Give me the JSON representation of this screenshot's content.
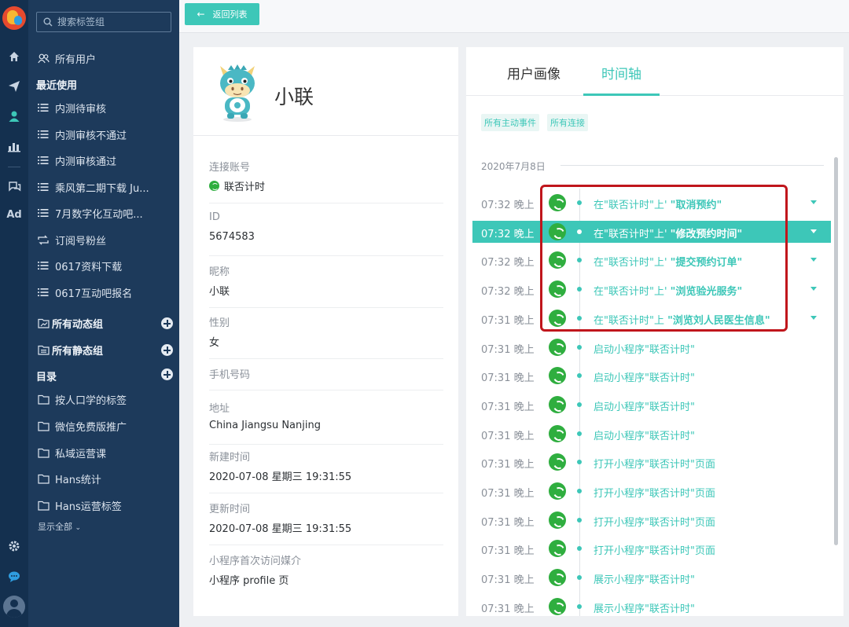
{
  "sidebar": {
    "search_placeholder": "搜索标签组",
    "all_users": "所有用户",
    "recent_header": "最近使用",
    "recent_items": [
      "内测待审核",
      "内测审核不通过",
      "内测审核通过",
      "乘风第二期下载 Ju...",
      "7月数字化互动吧...",
      "订阅号粉丝",
      "0617资料下载",
      "0617互动吧报名"
    ],
    "dynamic_group": "所有动态组",
    "static_group": "所有静态组",
    "catalog_header": "目录",
    "folders": [
      "按人口学的标签",
      "微信免费版推广",
      "私域运营课",
      "Hans统计",
      "Hans运营标签"
    ],
    "show_all": "显示全部"
  },
  "rail": {
    "ad_label": "Ad"
  },
  "topbar": {
    "back_label": "返回列表"
  },
  "profile": {
    "name": "小联",
    "fields": [
      {
        "label": "连接账号",
        "value": "联否计时"
      },
      {
        "label": "ID",
        "value": "5674583"
      },
      {
        "label": "昵称",
        "value": "小联"
      },
      {
        "label": "性别",
        "value": "女"
      },
      {
        "label": "手机号码",
        "value": ""
      },
      {
        "label": "地址",
        "value": "China Jiangsu Nanjing"
      },
      {
        "label": "新建时间",
        "value": "2020-07-08 星期三 19:31:55"
      },
      {
        "label": "更新时间",
        "value": "2020-07-08 星期三 19:31:55"
      },
      {
        "label": "小程序首次访问媒介",
        "value": "小程序 profile 页"
      }
    ]
  },
  "timeline": {
    "tabs": [
      "用户画像",
      "时间轴"
    ],
    "active_tab": "时间轴",
    "filters": [
      "所有主动事件",
      "所有连接"
    ],
    "date": "2020年7月8日",
    "rows": [
      {
        "time": "07:32 晚上",
        "prefix": "在\"联否计时\"上' ",
        "action": "\"取消预约\"",
        "expandable": true,
        "selected": false
      },
      {
        "time": "07:32 晚上",
        "prefix": "在\"联否计时\"上' ",
        "action": "\"修改预约时间\"",
        "expandable": true,
        "selected": true
      },
      {
        "time": "07:32 晚上",
        "prefix": "在\"联否计时\"上' ",
        "action": "\"提交预约订单\"",
        "expandable": true,
        "selected": false
      },
      {
        "time": "07:32 晚上",
        "prefix": "在\"联否计时\"上' ",
        "action": "\"浏览验光服务\"",
        "expandable": true,
        "selected": false
      },
      {
        "time": "07:31 晚上",
        "prefix": "在\"联否计时\"上 ",
        "action": "\"浏览刘人民医生信息\"",
        "expandable": true,
        "selected": false
      },
      {
        "time": "07:31 晚上",
        "prefix": "启动小程序\"联否计时\"",
        "action": "",
        "expandable": false,
        "selected": false
      },
      {
        "time": "07:31 晚上",
        "prefix": "启动小程序\"联否计时\"",
        "action": "",
        "expandable": false,
        "selected": false
      },
      {
        "time": "07:31 晚上",
        "prefix": "启动小程序\"联否计时\"",
        "action": "",
        "expandable": false,
        "selected": false
      },
      {
        "time": "07:31 晚上",
        "prefix": "启动小程序\"联否计时\"",
        "action": "",
        "expandable": false,
        "selected": false
      },
      {
        "time": "07:31 晚上",
        "prefix": "打开小程序\"联否计时\"页面",
        "action": "",
        "expandable": false,
        "selected": false
      },
      {
        "time": "07:31 晚上",
        "prefix": "打开小程序\"联否计时\"页面",
        "action": "",
        "expandable": false,
        "selected": false
      },
      {
        "time": "07:31 晚上",
        "prefix": "打开小程序\"联否计时\"页面",
        "action": "",
        "expandable": false,
        "selected": false
      },
      {
        "time": "07:31 晚上",
        "prefix": "打开小程序\"联否计时\"页面",
        "action": "",
        "expandable": false,
        "selected": false
      },
      {
        "time": "07:31 晚上",
        "prefix": "展示小程序\"联否计时\"",
        "action": "",
        "expandable": false,
        "selected": false
      },
      {
        "time": "07:31 晚上",
        "prefix": "展示小程序\"联否计时\"",
        "action": "",
        "expandable": false,
        "selected": false
      }
    ]
  },
  "colors": {
    "accent": "#3dc7b8",
    "sidebar_bg": "#1d3a5b",
    "rail_bg": "#14304f",
    "miniprogram_green": "#2fae3f",
    "highlight_red": "#c0161c"
  },
  "icons": {
    "rail": [
      "home-icon",
      "send-icon",
      "user-icon",
      "bar-chart-icon",
      "chat-icon",
      "settings-icon",
      "message-icon",
      "profile-icon"
    ],
    "event": "miniprogram-icon"
  }
}
